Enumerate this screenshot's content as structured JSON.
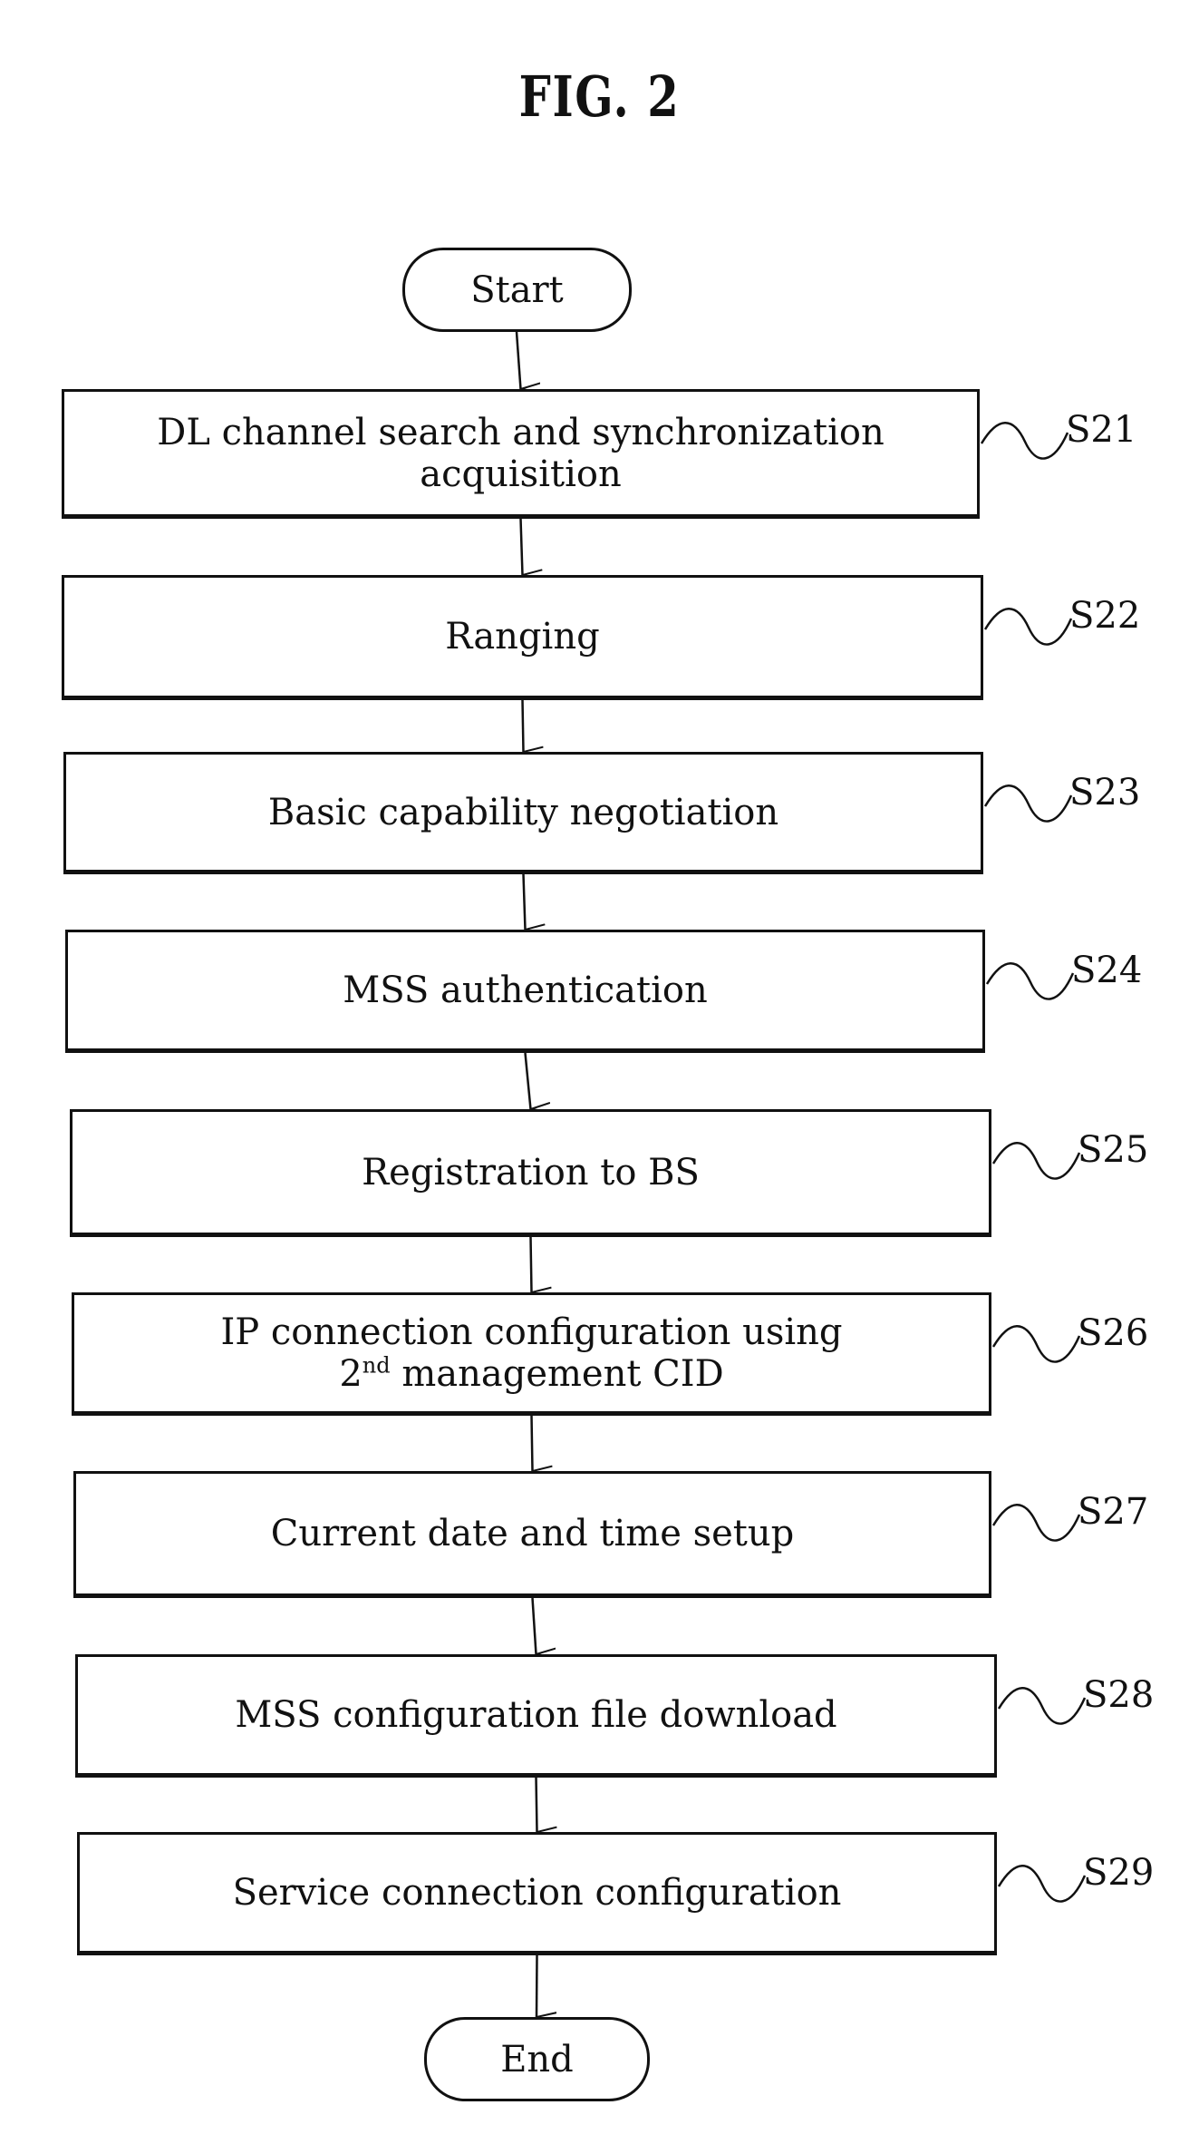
{
  "figure": {
    "title": "FIG. 2"
  },
  "flow": {
    "start": "Start",
    "end": "End",
    "steps": [
      {
        "id": "S21",
        "line1": "DL channel search and synchronization",
        "line2": "acquisition"
      },
      {
        "id": "S22",
        "line1": "Ranging",
        "line2": ""
      },
      {
        "id": "S23",
        "line1": "Basic capability negotiation",
        "line2": ""
      },
      {
        "id": "S24",
        "line1": "MSS authentication",
        "line2": ""
      },
      {
        "id": "S25",
        "line1": "Registration to BS",
        "line2": ""
      },
      {
        "id": "S26",
        "line1": "IP connection configuration using",
        "line2_prefix": "2",
        "line2_sup": "nd",
        "line2_suffix": " management CID"
      },
      {
        "id": "S27",
        "line1": "Current date and time setup",
        "line2": ""
      },
      {
        "id": "S28",
        "line1": "MSS configuration file download",
        "line2": ""
      },
      {
        "id": "S29",
        "line1": "Service connection configuration",
        "line2": ""
      }
    ]
  }
}
